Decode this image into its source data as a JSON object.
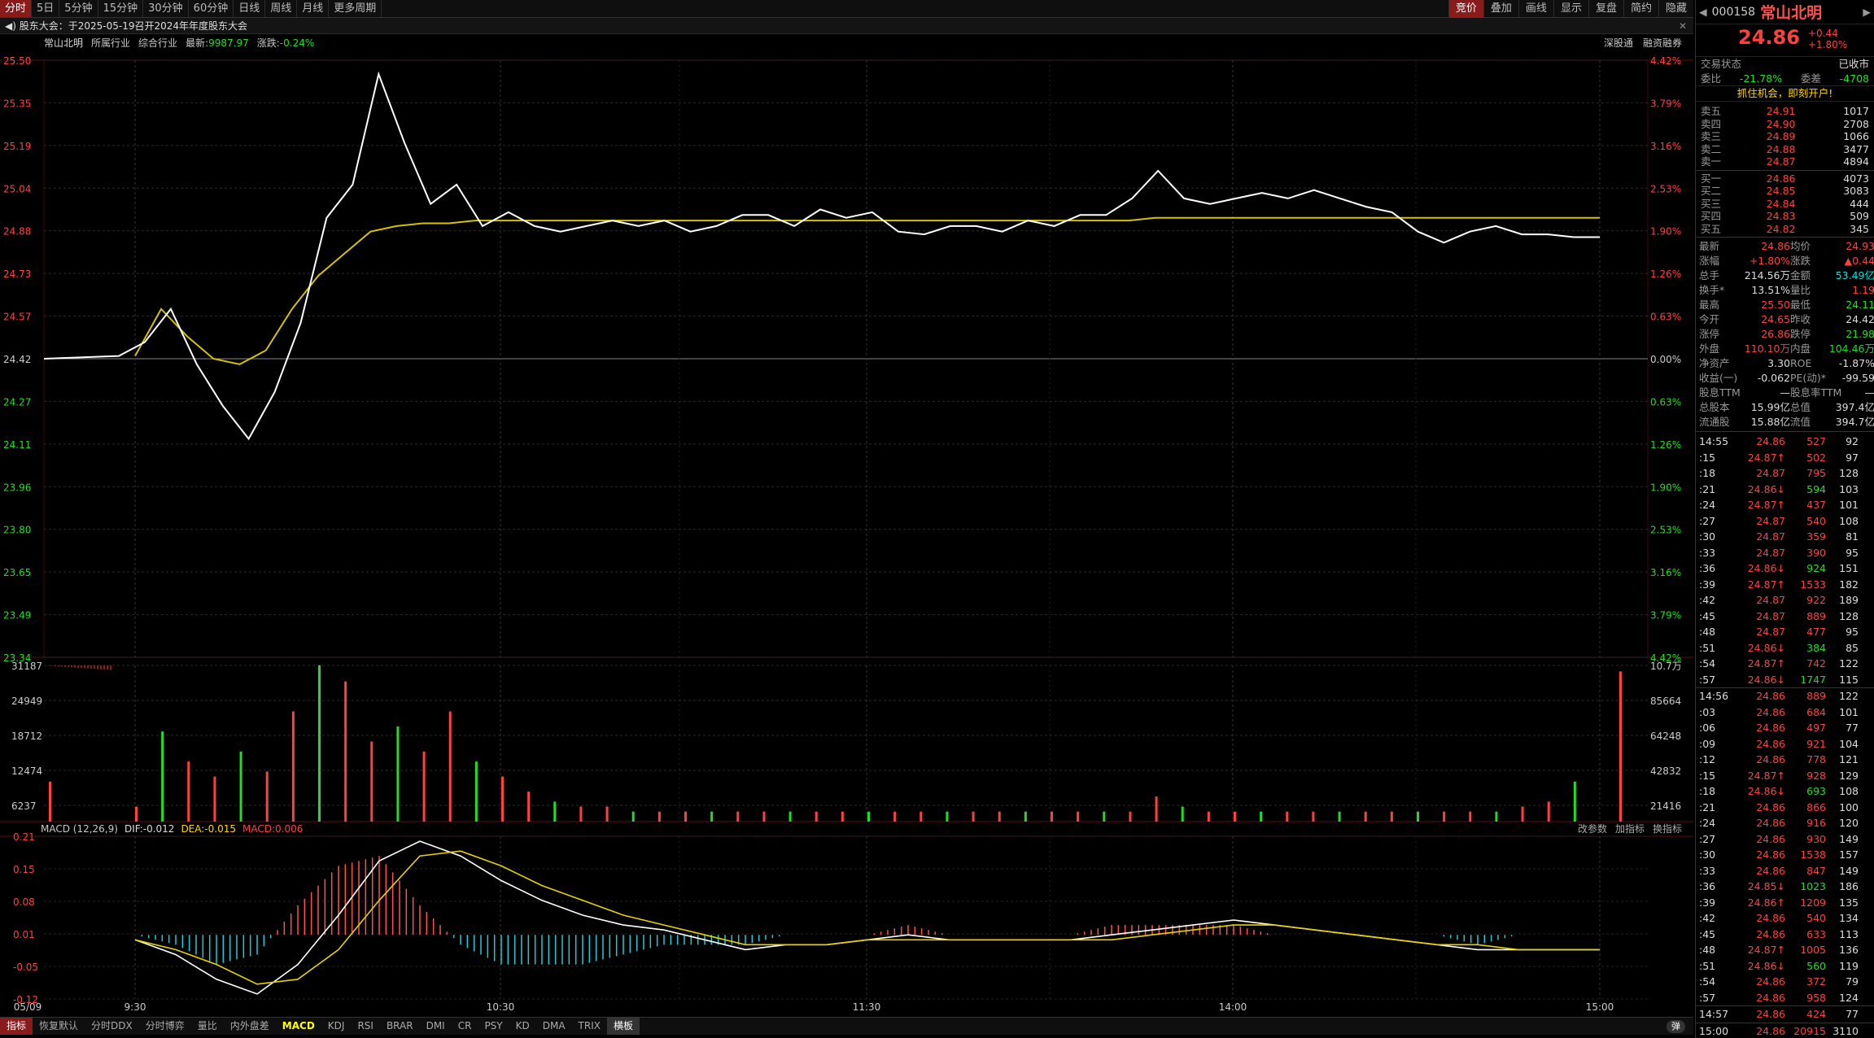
{
  "toolbar": {
    "items": [
      "分时",
      "5日",
      "5分钟",
      "15分钟",
      "30分钟",
      "60分钟",
      "日线",
      "周线",
      "月线",
      "更多周期"
    ],
    "right": [
      "竞价",
      "叠加",
      "画线",
      "显示",
      "复盘",
      "简约",
      "隐藏"
    ]
  },
  "notice": {
    "text": "股东大会：于2025-05-19召开2024年年度股东大会",
    "close": "✕"
  },
  "info": {
    "name": "常山北明",
    "industry_label": "所属行业",
    "industry": "综合行业",
    "latest_label": "最新",
    "latest": "9987.97",
    "chg_label": "涨跌",
    "chg": "-0.24%",
    "right1": "深股通",
    "right2": "融资融券"
  },
  "axes": {
    "price_left": [
      "25.50",
      "25.35",
      "25.19",
      "25.04",
      "24.88",
      "24.73",
      "24.57",
      "24.42",
      "24.27",
      "24.11",
      "23.96",
      "23.80",
      "23.65",
      "23.49",
      "23.34"
    ],
    "pct_right": [
      "4.42%",
      "3.79%",
      "3.16%",
      "2.53%",
      "1.90%",
      "1.26%",
      "0.63%",
      "0.00%",
      "0.63%",
      "1.26%",
      "1.90%",
      "2.53%",
      "3.16%",
      "3.79%",
      "4.42%"
    ],
    "vol_left": [
      "31187",
      "24949",
      "18712",
      "12474",
      "6237"
    ],
    "vol_right": [
      "10.7万",
      "85664",
      "64248",
      "42832",
      "21416"
    ],
    "macd_left": [
      "0.21",
      "0.15",
      "0.08",
      "0.01",
      "-0.05",
      "-0.12"
    ],
    "time": [
      "05/09",
      "9:30",
      "10:30",
      "11:30",
      "14:00",
      "15:00"
    ]
  },
  "macd": {
    "title": "MACD (12,26,9)",
    "dif": "DIF:-0.012",
    "dea": "DEA:-0.015",
    "macd": "MACD:0.006",
    "r1": "改参数",
    "r2": "加指标",
    "r3": "换指标"
  },
  "bottom": {
    "items": [
      "指标",
      "恢复默认",
      "分时DDX",
      "分时博弈",
      "量比",
      "内外盘差",
      "MACD",
      "KDJ",
      "RSI",
      "BRAR",
      "DMI",
      "CR",
      "PSY",
      "KD",
      "DMA",
      "TRIX",
      "横板"
    ],
    "toggle": "弹"
  },
  "colors": {
    "up": "#ff4040",
    "down": "#22dd22",
    "price_line": "#ffffff",
    "avg_line": "#d4c200",
    "dea": "#e6d200"
  },
  "chart_data": {
    "type": "line",
    "ylim": [
      23.34,
      25.5
    ],
    "prev_close": 24.42,
    "x": [
      "05/09",
      "9:30",
      "10:30",
      "11:30",
      "14:00",
      "15:00"
    ],
    "series": [
      {
        "values": [
          24.42,
          24.42,
          24.43,
          24.48,
          24.6,
          24.4,
          24.25,
          24.13,
          24.3,
          24.55,
          24.93,
          25.05,
          25.45,
          25.2,
          24.98,
          25.05,
          24.9,
          24.95,
          24.9,
          24.88,
          24.9,
          24.92,
          24.9,
          24.92,
          24.88,
          24.9,
          24.94,
          24.94,
          24.9,
          24.96,
          24.93,
          24.95,
          24.88,
          24.87,
          24.9,
          24.9,
          24.88,
          24.92,
          24.9,
          24.94,
          24.94,
          25.0,
          25.1,
          25.0,
          24.98,
          25.0,
          25.02,
          25.0,
          25.03,
          25.0,
          24.97,
          24.95,
          24.88,
          24.84,
          24.88,
          24.9,
          24.87,
          24.87,
          24.86,
          24.86
        ]
      },
      {
        "values": [
          24.42,
          24.42,
          24.42,
          24.43,
          24.6,
          24.5,
          24.42,
          24.4,
          24.45,
          24.6,
          24.72,
          24.8,
          24.88,
          24.9,
          24.91,
          24.91,
          24.92,
          24.92,
          24.92,
          24.92,
          24.92,
          24.92,
          24.92,
          24.92,
          24.92,
          24.92,
          24.92,
          24.92,
          24.92,
          24.92,
          24.92,
          24.92,
          24.92,
          24.92,
          24.92,
          24.92,
          24.92,
          24.92,
          24.92,
          24.92,
          24.92,
          24.92,
          24.93,
          24.93,
          24.93,
          24.93,
          24.93,
          24.93,
          24.93,
          24.93,
          24.93,
          24.93,
          24.93,
          24.93,
          24.93,
          24.93,
          24.93,
          24.93,
          24.93,
          24.93
        ]
      }
    ],
    "volume": [
      8000,
      0,
      0,
      3000,
      18000,
      12000,
      9000,
      14000,
      10000,
      22000,
      31187,
      28000,
      16000,
      19000,
      14000,
      22000,
      12000,
      9000,
      6000,
      4000,
      3000,
      3000,
      2000,
      2000,
      2000,
      2000,
      2000,
      2000,
      2000,
      2000,
      2000,
      2000,
      2000,
      2000,
      2000,
      2000,
      2000,
      2000,
      2000,
      2000,
      2000,
      2000,
      5000,
      3000,
      2000,
      2000,
      2000,
      2000,
      2000,
      2000,
      2000,
      2000,
      2000,
      2000,
      2000,
      2000,
      3000,
      4000,
      8000,
      30000
    ],
    "macd_dif": [
      0,
      -0.03,
      -0.08,
      -0.11,
      -0.05,
      0.05,
      0.16,
      0.2,
      0.17,
      0.12,
      0.08,
      0.05,
      0.03,
      0.02,
      0.0,
      -0.02,
      -0.01,
      -0.01,
      0.0,
      0.01,
      0.0,
      0.0,
      0.0,
      0.0,
      0.01,
      0.02,
      0.03,
      0.04,
      0.03,
      0.02,
      0.01,
      0.0,
      -0.01,
      -0.02,
      -0.02,
      -0.02,
      -0.02
    ],
    "macd_dea": [
      0,
      -0.02,
      -0.05,
      -0.09,
      -0.08,
      -0.02,
      0.08,
      0.17,
      0.18,
      0.15,
      0.11,
      0.08,
      0.05,
      0.03,
      0.01,
      -0.01,
      -0.01,
      -0.01,
      0.0,
      0.0,
      0.0,
      0.0,
      0.0,
      0.0,
      0.0,
      0.01,
      0.02,
      0.03,
      0.03,
      0.02,
      0.01,
      0.0,
      -0.01,
      -0.01,
      -0.02,
      -0.02,
      -0.02
    ]
  },
  "quote": {
    "code": "000158",
    "name": "常山北明",
    "price": "24.86",
    "chg": "+0.44",
    "pct": "+1.80%",
    "status_label": "交易状态",
    "status": "已收市",
    "wb_label": "委比",
    "wb": "-21.78%",
    "wc_label": "委差",
    "wc": "-4708",
    "promo": "抓住机会，即刻开户!",
    "asks": [
      [
        "卖五",
        "24.91",
        "1017"
      ],
      [
        "卖四",
        "24.90",
        "2708"
      ],
      [
        "卖三",
        "24.89",
        "1066"
      ],
      [
        "卖二",
        "24.88",
        "3477"
      ],
      [
        "卖一",
        "24.87",
        "4894"
      ]
    ],
    "bids": [
      [
        "买一",
        "24.86",
        "4073"
      ],
      [
        "买二",
        "24.85",
        "3083"
      ],
      [
        "买三",
        "24.84",
        "444"
      ],
      [
        "买四",
        "24.83",
        "509"
      ],
      [
        "买五",
        "24.82",
        "345"
      ]
    ],
    "stats": [
      [
        "最新",
        "24.86",
        "均价",
        "24.93"
      ],
      [
        "涨幅",
        "+1.80%",
        "涨跌",
        "▲0.44"
      ],
      [
        "总手",
        "214.56万",
        "金额",
        "53.49亿"
      ],
      [
        "换手*",
        "13.51%",
        "量比",
        "1.19"
      ],
      [
        "最高",
        "25.50",
        "最低",
        "24.11"
      ],
      [
        "今开",
        "24.65",
        "昨收",
        "24.42"
      ],
      [
        "涨停",
        "26.86",
        "跌停",
        "21.98"
      ],
      [
        "外盘",
        "110.10万",
        "内盘",
        "104.46万"
      ],
      [
        "净资产",
        "3.30",
        "ROE",
        "-1.87%"
      ],
      [
        "收益(一)",
        "-0.062",
        "PE(动)*",
        "-99.59"
      ],
      [
        "股息TTM",
        "—",
        "股息率TTM",
        "—"
      ],
      [
        "总股本",
        "15.99亿",
        "总值",
        "397.4亿"
      ],
      [
        "流通股",
        "15.88亿",
        "流值",
        "394.7亿"
      ]
    ],
    "ticks": [
      [
        "14:55",
        "24.86",
        "527",
        "92"
      ],
      [
        ":15",
        "24.87↑",
        "502",
        "97"
      ],
      [
        ":18",
        "24.87",
        "795",
        "128"
      ],
      [
        ":21",
        "24.86↓",
        "594",
        "103"
      ],
      [
        ":24",
        "24.87↑",
        "437",
        "101"
      ],
      [
        ":27",
        "24.87",
        "540",
        "108"
      ],
      [
        ":30",
        "24.87",
        "359",
        "81"
      ],
      [
        ":33",
        "24.87",
        "390",
        "95"
      ],
      [
        ":36",
        "24.86↓",
        "924",
        "151"
      ],
      [
        ":39",
        "24.87↑",
        "1533",
        "182"
      ],
      [
        ":42",
        "24.87",
        "922",
        "189"
      ],
      [
        ":45",
        "24.87",
        "889",
        "128"
      ],
      [
        ":48",
        "24.87",
        "477",
        "95"
      ],
      [
        ":51",
        "24.86↓",
        "384",
        "85"
      ],
      [
        ":54",
        "24.87↑",
        "742",
        "122"
      ],
      [
        ":57",
        "24.86↓",
        "1747",
        "115"
      ],
      [
        "14:56",
        "24.86",
        "889",
        "122"
      ],
      [
        ":03",
        "24.86",
        "684",
        "101"
      ],
      [
        ":06",
        "24.86",
        "497",
        "77"
      ],
      [
        ":09",
        "24.86",
        "921",
        "104"
      ],
      [
        ":12",
        "24.86",
        "778",
        "121"
      ],
      [
        ":15",
        "24.87↑",
        "928",
        "129"
      ],
      [
        ":18",
        "24.86↓",
        "693",
        "108"
      ],
      [
        ":21",
        "24.86",
        "866",
        "100"
      ],
      [
        ":24",
        "24.86",
        "916",
        "120"
      ],
      [
        ":27",
        "24.86",
        "930",
        "149"
      ],
      [
        ":30",
        "24.86",
        "1538",
        "157"
      ],
      [
        ":33",
        "24.86",
        "847",
        "149"
      ],
      [
        ":36",
        "24.85↓",
        "1023",
        "186"
      ],
      [
        ":39",
        "24.86↑",
        "1209",
        "135"
      ],
      [
        ":42",
        "24.86",
        "540",
        "134"
      ],
      [
        ":45",
        "24.86",
        "633",
        "113"
      ],
      [
        ":48",
        "24.87↑",
        "1005",
        "136"
      ],
      [
        ":51",
        "24.86↓",
        "560",
        "119"
      ],
      [
        ":54",
        "24.86",
        "372",
        "79"
      ],
      [
        ":57",
        "24.86",
        "958",
        "124"
      ],
      [
        "14:57",
        "24.86",
        "424",
        "77"
      ],
      [
        "15:00",
        "24.86",
        "20915",
        "3110"
      ]
    ]
  }
}
